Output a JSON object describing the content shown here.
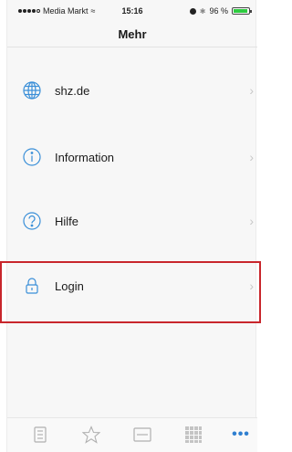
{
  "statusbar": {
    "carrier": "Media Markt",
    "time": "15:16",
    "battery": "96 %",
    "battery_level": 0.96
  },
  "navbar": {
    "title": "Mehr"
  },
  "menu": {
    "items": [
      {
        "label": "shz.de",
        "icon": "globe-icon"
      },
      {
        "label": "Information",
        "icon": "info-icon"
      },
      {
        "label": "Hilfe",
        "icon": "help-icon"
      },
      {
        "label": "Login",
        "icon": "lock-icon"
      }
    ],
    "chevron": "›"
  },
  "tabbar": {
    "tabs": [
      {
        "icon": "epaper-icon"
      },
      {
        "icon": "favorites-icon"
      },
      {
        "icon": "news-icon"
      },
      {
        "icon": "grid-icon"
      },
      {
        "icon": "more-icon",
        "label": "•••",
        "active": true
      }
    ],
    "active_color": "#2f7fd0"
  },
  "highlight_color": "#c8262c"
}
